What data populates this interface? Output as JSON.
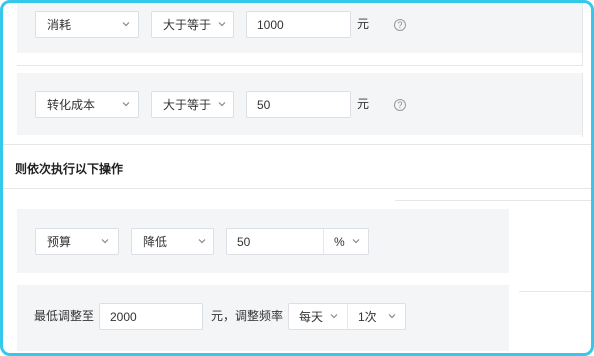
{
  "rule_rows": [
    {
      "metric": "消耗",
      "operator": "大于等于",
      "value": "1000",
      "unit": "元",
      "help_glyph": "?"
    },
    {
      "metric": "转化成本",
      "operator": "大于等于",
      "value": "50",
      "unit": "元",
      "help_glyph": "?"
    }
  ],
  "section_title": "则依次执行以下操作",
  "action": {
    "target": "预算",
    "direction": "降低",
    "amount": "50",
    "amount_unit": "%"
  },
  "limit": {
    "label": "最低调整至",
    "value": "2000",
    "unit_text": "元，调整频率",
    "frequency_period": "每天",
    "frequency_count": "1次"
  },
  "colors": {
    "frame_border": "#33c9ec",
    "panel_bg": "#f4f5f7",
    "input_border": "#dcdfe6"
  },
  "icons": {
    "chevron": "chevron-down-icon",
    "help": "question-circle-icon"
  }
}
